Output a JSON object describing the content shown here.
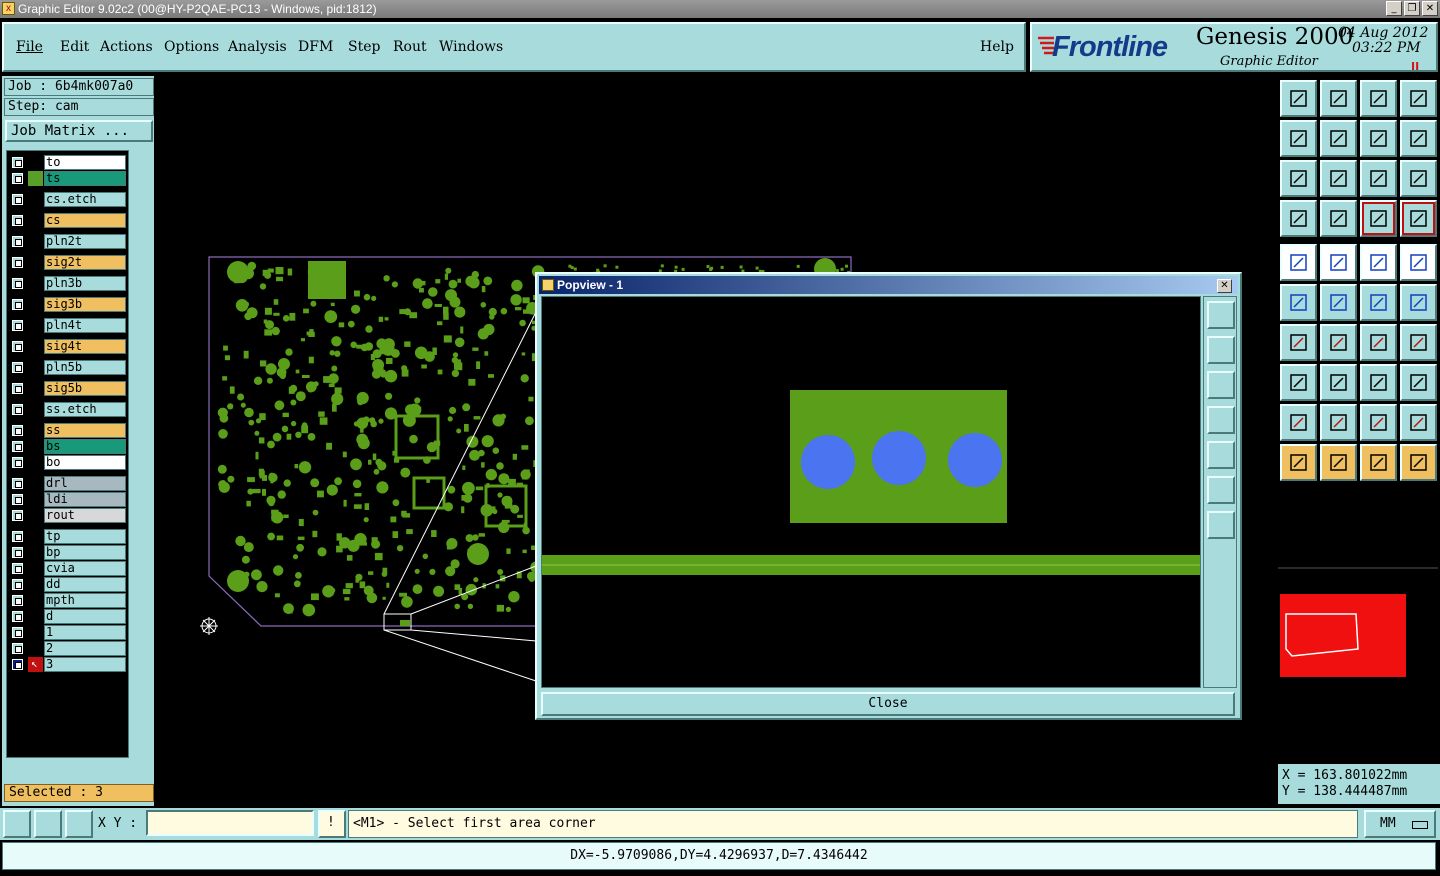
{
  "window": {
    "title": "Graphic Editor 9.02c2 (00@HY-P2QAE-PC13 - Windows, pid:1812)"
  },
  "menu": {
    "items": [
      "File",
      "Edit",
      "Actions",
      "Options",
      "Analysis",
      "DFM",
      "Step",
      "Rout",
      "Windows"
    ],
    "help": "Help"
  },
  "brand": {
    "logo": "Frontline",
    "product": "Genesis 2000",
    "subtitle": "Graphic Editor",
    "date": "04 Aug 2012",
    "time": "03:22 PM",
    "pause": "II"
  },
  "job": {
    "job_line": "Job : 6b4mk007a0",
    "step_line": "Step: cam",
    "matrix_button": "Job Matrix ..."
  },
  "layers": [
    {
      "name": "to",
      "color": "#ffffff",
      "side": "#000000"
    },
    {
      "name": "ts",
      "color": "#189a7a",
      "side": "#5a9e2a"
    },
    {
      "name": "cs.etch",
      "color": "#a8dcdc",
      "side": "#000000"
    },
    {
      "name": "cs",
      "color": "#f0c060",
      "side": "#000000"
    },
    {
      "name": "pln2t",
      "color": "#a8dcdc",
      "side": "#000000"
    },
    {
      "name": "sig2t",
      "color": "#f0c060",
      "side": "#000000"
    },
    {
      "name": "pln3b",
      "color": "#a8dcdc",
      "side": "#000000"
    },
    {
      "name": "sig3b",
      "color": "#f0c060",
      "side": "#000000"
    },
    {
      "name": "pln4t",
      "color": "#a8dcdc",
      "side": "#000000"
    },
    {
      "name": "sig4t",
      "color": "#f0c060",
      "side": "#000000"
    },
    {
      "name": "pln5b",
      "color": "#a8dcdc",
      "side": "#000000"
    },
    {
      "name": "sig5b",
      "color": "#f0c060",
      "side": "#000000"
    },
    {
      "name": "ss.etch",
      "color": "#a8dcdc",
      "side": "#000000"
    },
    {
      "name": "ss",
      "color": "#f0c060",
      "side": "#000000"
    },
    {
      "name": "bs",
      "color": "#189a7a",
      "side": "#000000"
    },
    {
      "name": "bo",
      "color": "#ffffff",
      "side": "#000000"
    },
    {
      "name": "drl",
      "color": "#a8b8c0",
      "side": "#000000"
    },
    {
      "name": "ldi",
      "color": "#a8b8c0",
      "side": "#000000"
    },
    {
      "name": "rout",
      "color": "#d8d8d8",
      "side": "#000000"
    },
    {
      "name": "tp",
      "color": "#a8dcdc",
      "side": "#000000"
    },
    {
      "name": "bp",
      "color": "#a8dcdc",
      "side": "#000000"
    },
    {
      "name": "cvia",
      "color": "#a8dcdc",
      "side": "#000000"
    },
    {
      "name": "dd",
      "color": "#a8dcdc",
      "side": "#000000"
    },
    {
      "name": "mpth",
      "color": "#a8dcdc",
      "side": "#000000"
    },
    {
      "name": "d",
      "color": "#a8dcdc",
      "side": "#000000"
    },
    {
      "name": "1",
      "color": "#a8dcdc",
      "side": "#000000"
    },
    {
      "name": "2",
      "color": "#a8dcdc",
      "side": "#000000"
    },
    {
      "name": "3",
      "color": "#a8dcdc",
      "side": "#000000"
    }
  ],
  "selected": "Selected : 3",
  "popview": {
    "title": "Popview - 1",
    "close_label": "Close"
  },
  "coords": {
    "x": "X =  163.801022mm",
    "y": "Y =  138.444487mm"
  },
  "command": {
    "xy_label": "X Y :",
    "xy_value": "",
    "prompt": "<M1> - Select first area corner",
    "units": "MM"
  },
  "status": "DX=-5.9709086,DY=4.4296937,D=7.4346442",
  "colors": {
    "panel": "#a8dcdc",
    "copper": "#5a9e1a",
    "pad": "#4a74f0",
    "accent_yellow": "#f0c060"
  }
}
